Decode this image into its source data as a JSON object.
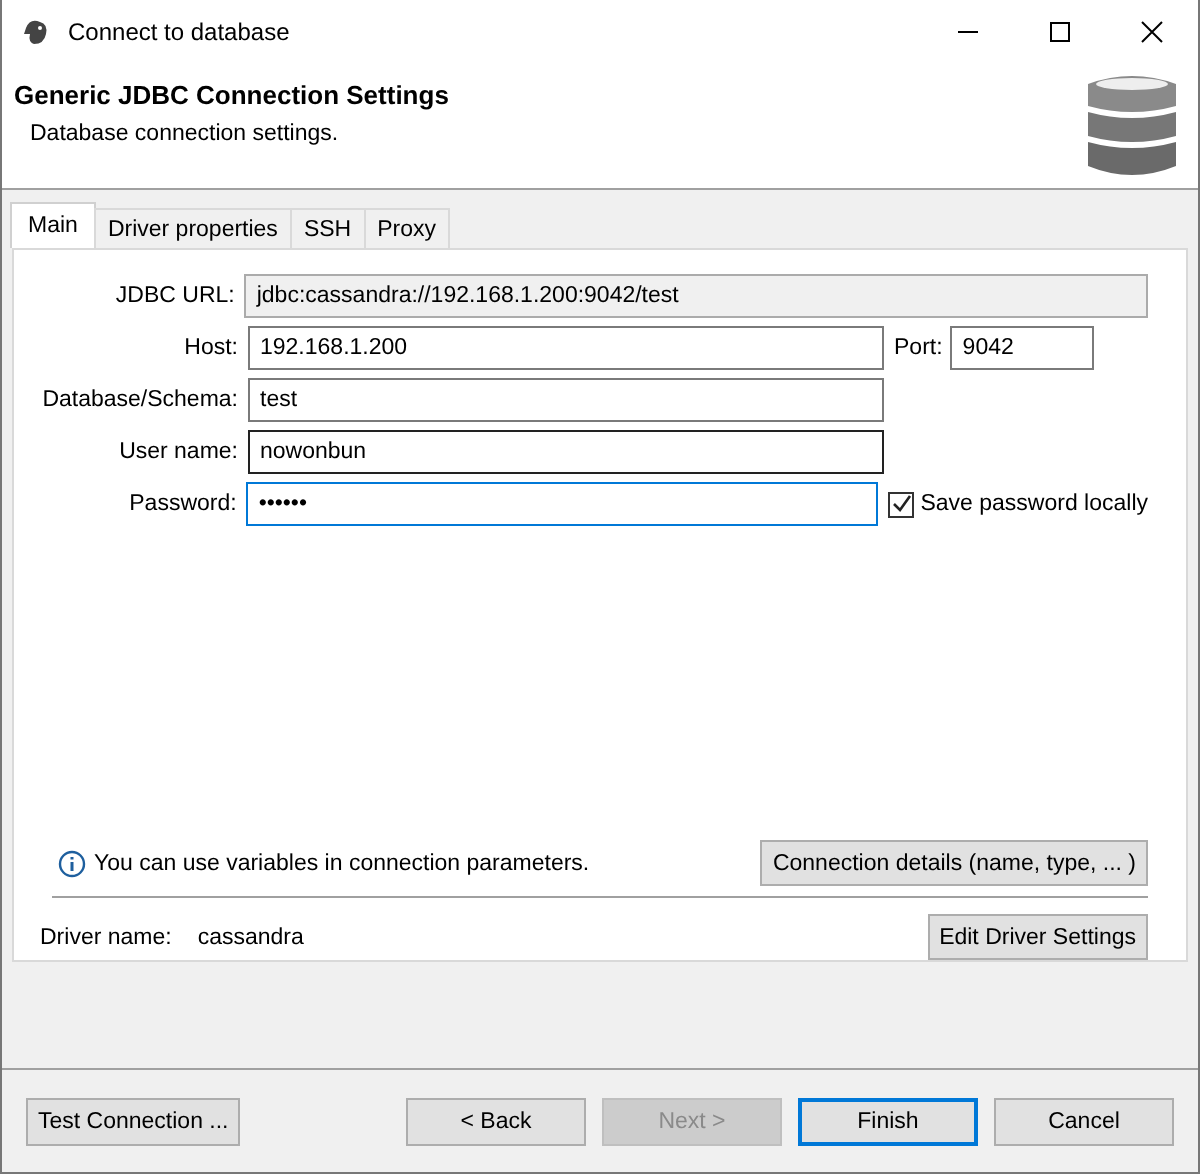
{
  "window": {
    "title": "Connect to database"
  },
  "header": {
    "title": "Generic JDBC Connection Settings",
    "subtitle": "Database connection settings."
  },
  "tabs": [
    {
      "label": "Main",
      "selected": true
    },
    {
      "label": "Driver properties",
      "selected": false
    },
    {
      "label": "SSH",
      "selected": false
    },
    {
      "label": "Proxy",
      "selected": false
    }
  ],
  "fields": [
    {
      "label": "JDBC URL:",
      "value": "jdbc:cassandra://192.168.1.200:9042/test",
      "kind": "readonly",
      "focused": false,
      "hovered": false
    },
    {
      "label": "Host:",
      "value": "192.168.1.200",
      "kind": "host",
      "focused": false,
      "hovered": false
    },
    {
      "label": "Database/Schema:",
      "value": "test",
      "kind": "text",
      "focused": false,
      "hovered": false
    },
    {
      "label": "User name:",
      "value": "nowonbun",
      "kind": "text",
      "focused": false,
      "hovered": true
    },
    {
      "label": "Password:",
      "value": "••••••",
      "kind": "password",
      "focused": true,
      "hovered": false
    }
  ],
  "port": {
    "label": "Port:",
    "value": "9042"
  },
  "save_password": {
    "label": "Save password locally",
    "checked": true
  },
  "info": {
    "text": "You can use variables in connection parameters."
  },
  "connection_details_button": "Connection details (name, type, ... )",
  "driver": {
    "label": "Driver name:",
    "value": "cassandra"
  },
  "edit_driver_button": "Edit Driver Settings",
  "buttons": [
    {
      "label": "Test Connection ...",
      "disabled": false,
      "default": false
    },
    {
      "label": "< Back",
      "disabled": false,
      "default": false
    },
    {
      "label": "Next >",
      "disabled": true,
      "default": false
    },
    {
      "label": "Finish",
      "disabled": false,
      "default": true
    },
    {
      "label": "Cancel",
      "disabled": false,
      "default": false
    }
  ]
}
